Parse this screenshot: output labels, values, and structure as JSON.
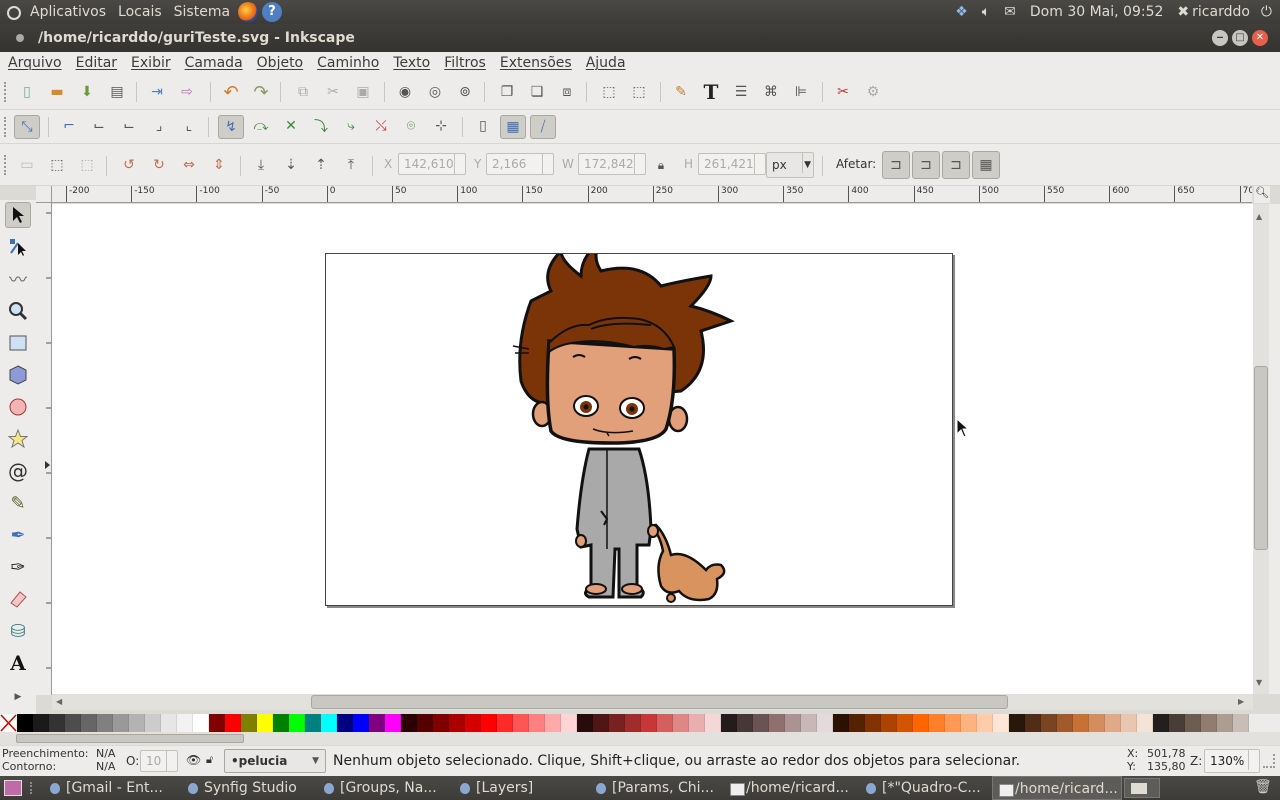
{
  "top_panel": {
    "menus": [
      "Aplicativos",
      "Locais",
      "Sistema"
    ],
    "datetime": "Dom 30 Mai, 09:52",
    "user": "ricarddo"
  },
  "window": {
    "title": "/home/ricarddo/guriTeste.svg - Inkscape"
  },
  "menubar": [
    "Arquivo",
    "Editar",
    "Exibir",
    "Camada",
    "Objeto",
    "Caminho",
    "Texto",
    "Filtros",
    "Extensões",
    "Ajuda"
  ],
  "select_toolbar": {
    "x_label": "X",
    "x_value": "142,610",
    "y_label": "Y",
    "y_value": "2,166",
    "w_label": "W",
    "w_value": "172,842",
    "h_label": "H",
    "h_value": "261,421",
    "unit": "px",
    "affect_label": "Afetar:"
  },
  "ruler": {
    "labels": [
      "-200",
      "-150",
      "-100",
      "-50",
      "0",
      "50",
      "100",
      "150",
      "200",
      "250",
      "300",
      "350",
      "400",
      "450",
      "500",
      "550",
      "600",
      "650",
      "70"
    ]
  },
  "palette": {
    "colors": [
      "#000000",
      "#1a1a1a",
      "#333333",
      "#4d4d4d",
      "#666666",
      "#808080",
      "#999999",
      "#b3b3b3",
      "#cccccc",
      "#e6e6e6",
      "#f2f2f2",
      "#ffffff",
      "#800000",
      "#ff0000",
      "#808000",
      "#ffff00",
      "#008000",
      "#00ff00",
      "#008080",
      "#00ffff",
      "#000080",
      "#0000ff",
      "#800080",
      "#ff00ff",
      "#2b0000",
      "#550000",
      "#800000",
      "#aa0000",
      "#d40000",
      "#ff0000",
      "#ff2a2a",
      "#ff5555",
      "#ff8080",
      "#ffaaaa",
      "#ffd5d5",
      "#280b0b",
      "#501616",
      "#782121",
      "#a02c2c",
      "#c83737",
      "#d35f5f",
      "#de8787",
      "#e9afaf",
      "#f4d7d7",
      "#241c1c",
      "#483737",
      "#6c5353",
      "#916f6f",
      "#ac9393",
      "#c8b7b7",
      "#e3dbdb",
      "#2b1100",
      "#552200",
      "#803300",
      "#aa4400",
      "#d45500",
      "#ff6600",
      "#ff7f2a",
      "#ff9955",
      "#ffb380",
      "#ffccaa",
      "#ffe6d5",
      "#28170b",
      "#502d16",
      "#784421",
      "#a05a2c",
      "#c87137",
      "#d38d5f",
      "#deaa87",
      "#e9c6af",
      "#f4e3d7",
      "#241f1c",
      "#483e37",
      "#6c5d53",
      "#917c6f",
      "#ac9d93",
      "#c8beb7"
    ]
  },
  "status": {
    "fill_label": "Preenchimento:",
    "fill_value": "N/A",
    "stroke_label": "Contorno:",
    "stroke_value": "N/A",
    "opacity_label": "O:",
    "opacity_value": "10",
    "layer": "•pelucia",
    "message": "Nenhum objeto selecionado. Clique, Shift+clique, ou arraste ao redor dos objetos para selecionar.",
    "coord_x_label": "X:",
    "coord_x": "501,78",
    "coord_y_label": "Y:",
    "coord_y": "135,80",
    "zoom_label": "Z:",
    "zoom": "130%"
  },
  "taskbar": {
    "items": [
      "[Gmail - Ent...",
      "Synfig Studio",
      "[Groups, Na...",
      "[Layers]",
      "[Params, Chi...",
      "/home/ricard...",
      "[*\"Quadro-C...",
      "/home/ricard..."
    ]
  }
}
